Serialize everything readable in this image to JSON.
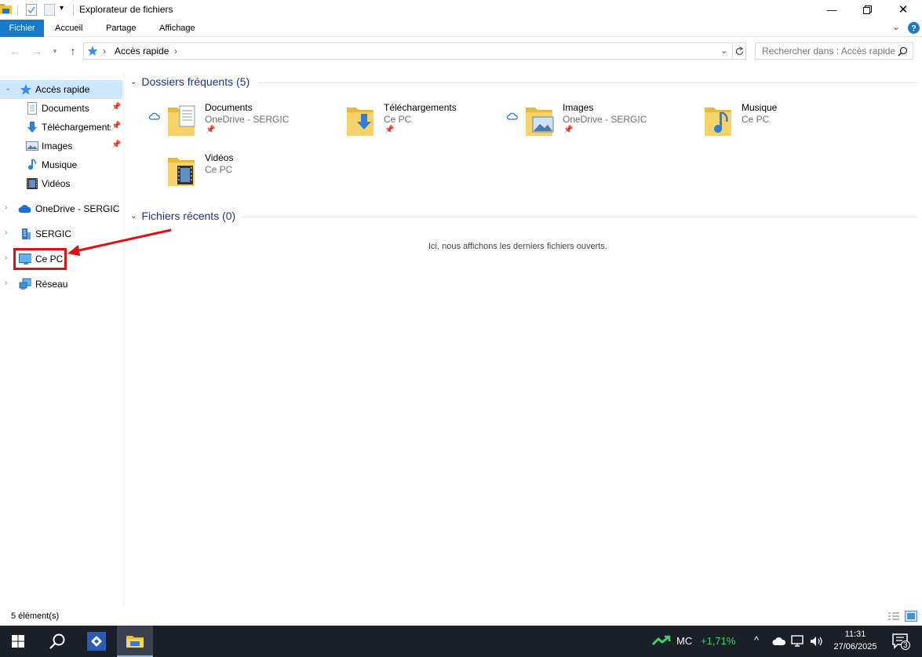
{
  "window": {
    "title": "Explorateur de fichiers"
  },
  "ribbon": {
    "tabs": [
      {
        "label": "Fichier"
      },
      {
        "label": "Accueil"
      },
      {
        "label": "Partage"
      },
      {
        "label": "Affichage"
      }
    ]
  },
  "address": {
    "crumb": "Accès rapide",
    "separator": "›",
    "search_placeholder": "Rechercher dans : Accès rapide"
  },
  "nav": {
    "quick_access": "Accès rapide",
    "pinned": [
      {
        "label": "Documents"
      },
      {
        "label": "Téléchargements"
      },
      {
        "label": "Images"
      },
      {
        "label": "Musique"
      },
      {
        "label": "Vidéos"
      }
    ],
    "roots": [
      {
        "label": "OneDrive - SERGIC"
      },
      {
        "label": "SERGIC"
      },
      {
        "label": "Ce PC"
      },
      {
        "label": "Réseau"
      }
    ]
  },
  "content": {
    "frequent_header": "Dossiers fréquents (5)",
    "recent_header": "Fichiers récents (0)",
    "empty_message": "Ici, nous affichons les derniers fichiers ouverts.",
    "folders": [
      {
        "name": "Documents",
        "location": "OneDrive - SERGIC",
        "cloud": true,
        "pinned": true
      },
      {
        "name": "Téléchargements",
        "location": "Ce PC",
        "cloud": false,
        "pinned": true
      },
      {
        "name": "Images",
        "location": "OneDrive - SERGIC",
        "cloud": true,
        "pinned": true
      },
      {
        "name": "Musique",
        "location": "Ce PC",
        "cloud": false,
        "pinned": false
      },
      {
        "name": "Vidéos",
        "location": "Ce PC",
        "cloud": false,
        "pinned": false
      }
    ]
  },
  "status": {
    "count": "5 élément(s)"
  },
  "taskbar": {
    "ticker_symbol": "MC",
    "ticker_change": "+1,71%",
    "time": "11:31",
    "date": "27/06/2025",
    "notifications": "3"
  },
  "colors": {
    "accent": "#1979ca",
    "selection": "#cce8ff",
    "group_header": "#1e3287",
    "highlight": "#e01010",
    "ticker_up": "#3fd16a",
    "taskbar": "#1b2028"
  }
}
